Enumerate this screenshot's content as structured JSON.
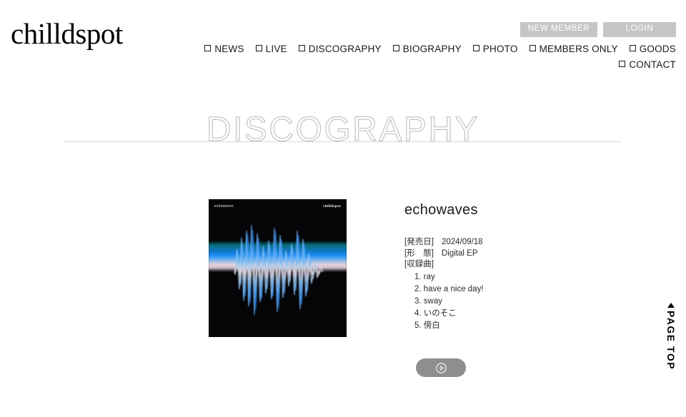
{
  "site": {
    "logo": "chilldspot"
  },
  "auth": {
    "new_member": "NEW MEMBER",
    "login": "LOGIN"
  },
  "nav": {
    "items": [
      {
        "label": "NEWS",
        "icon": "square-checkbox-icon"
      },
      {
        "label": "LIVE",
        "icon": "square-checkbox-icon"
      },
      {
        "label": "DISCOGRAPHY",
        "icon": "square-checkbox-icon"
      },
      {
        "label": "BIOGRAPHY",
        "icon": "square-checkbox-icon"
      },
      {
        "label": "PHOTO",
        "icon": "square-checkbox-icon"
      },
      {
        "label": "MEMBERS ONLY",
        "icon": "square-checkbox-icon"
      },
      {
        "label": "GOODS",
        "icon": "square-checkbox-icon"
      },
      {
        "label": "CONTACT",
        "icon": "square-checkbox-icon"
      }
    ]
  },
  "page": {
    "title": "DISCOGRAPHY"
  },
  "release": {
    "cover": {
      "title_text": "echowaves",
      "artist_text": "chilldspot"
    },
    "title": "echowaves",
    "meta": [
      {
        "label": "[発売日]",
        "value": "2024/09/18"
      },
      {
        "label": "[形　態]",
        "value": "Digital EP"
      }
    ],
    "tracklist_label": "[収録曲]",
    "tracks": [
      "1. ray",
      "2. have a nice day!",
      "3. sway",
      "4. いのそこ",
      "5. 傍白"
    ]
  },
  "play": {
    "icon": "play-circle-icon"
  },
  "page_top": {
    "label": "PAGE TOP",
    "icon": "triangle-up-icon"
  },
  "colors": {
    "button_gray": "#c6c6c6",
    "play_button_gray": "#8e8e8e",
    "title_outline": "#b9b9b9",
    "divider": "#a8a8a8",
    "cover_black": "#050507",
    "wave_blue": "#1f8ef5",
    "wave_teal": "#0a6e7a",
    "wave_highlight": "#e6d2dc"
  }
}
